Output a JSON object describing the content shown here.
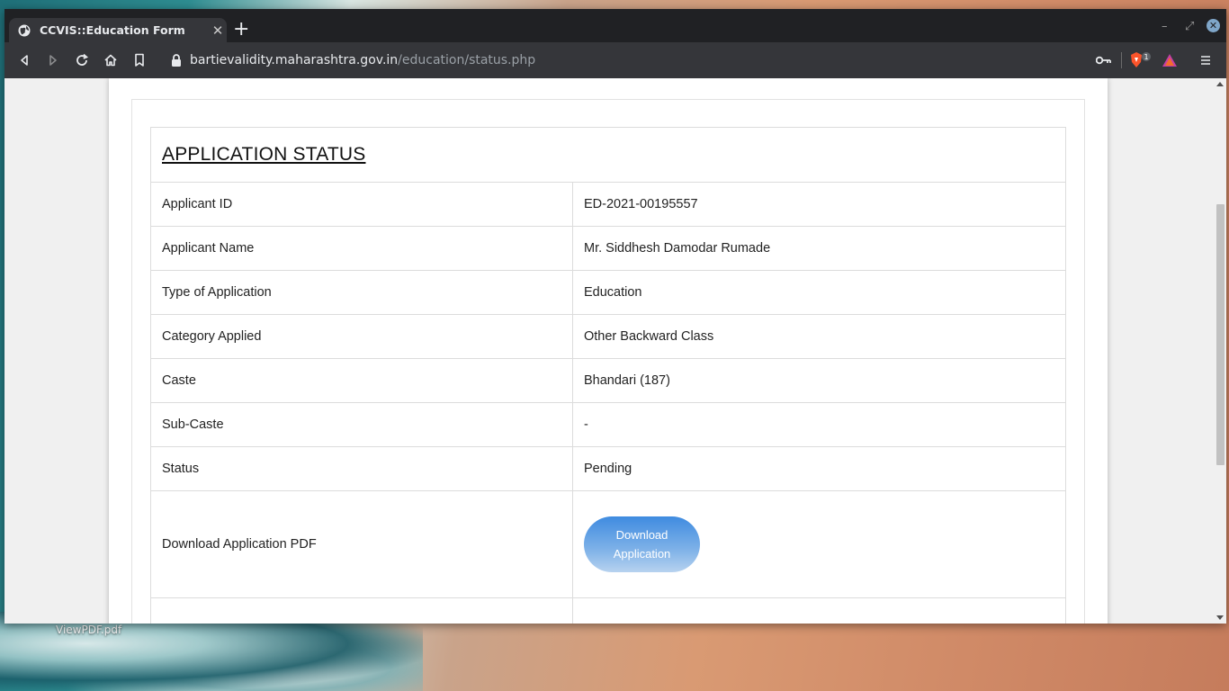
{
  "browser": {
    "tab_title": "CCVIS::Education Form",
    "url_domain": "bartievalidity.maharashtra.gov.in",
    "url_path": "/education/status.php",
    "extension_badge": "1"
  },
  "desktop": {
    "file_label": "ViewPDF.pdf"
  },
  "page": {
    "heading": "APPLICATION STATUS",
    "rows": [
      {
        "label": "Applicant ID",
        "value": "ED-2021-00195557"
      },
      {
        "label": "Applicant Name",
        "value": "Mr. Siddhesh Damodar Rumade"
      },
      {
        "label": "Type of Application",
        "value": "Education"
      },
      {
        "label": "Category Applied",
        "value": "Other Backward Class"
      },
      {
        "label": "Caste",
        "value": "Bhandari (187)"
      },
      {
        "label": "Sub-Caste",
        "value": "-"
      },
      {
        "label": "Status",
        "value": "Pending"
      }
    ],
    "download_label": "Download Application PDF",
    "download_button": "Download Application"
  },
  "colors": {
    "button_top": "#3f8be0",
    "button_bottom": "#b7d2ef",
    "chrome_dark": "#202124",
    "toolbar": "#35363a"
  },
  "icons": [
    "globe-icon",
    "close-icon",
    "plus-icon",
    "back-icon",
    "forward-icon",
    "reload-icon",
    "home-icon",
    "bookmark-icon",
    "lock-icon",
    "key-icon",
    "brave-shield-icon",
    "brave-rewards-icon",
    "menu-icon"
  ]
}
